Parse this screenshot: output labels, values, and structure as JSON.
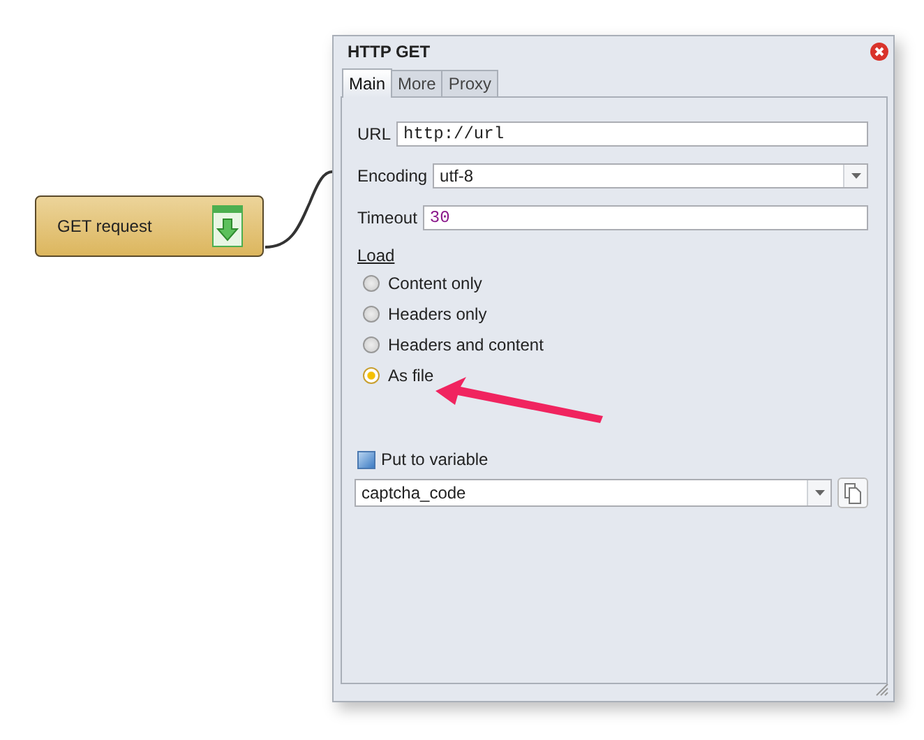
{
  "node": {
    "label": "GET request"
  },
  "dialog": {
    "title": "HTTP GET",
    "tabs": [
      {
        "label": "Main",
        "selected": true
      },
      {
        "label": "More",
        "selected": false
      },
      {
        "label": "Proxy",
        "selected": false
      }
    ],
    "fields": [
      {
        "kind": "code",
        "label": "URL",
        "value": "http://url"
      },
      {
        "kind": "combo",
        "label": "Encoding",
        "value": "utf-8"
      },
      {
        "kind": "number",
        "label": "Timeout",
        "value": "30"
      }
    ],
    "load": {
      "label": "Load",
      "options": [
        {
          "label": "Content only",
          "selected": false
        },
        {
          "label": "Headers only",
          "selected": false
        },
        {
          "label": "Headers and content",
          "selected": false
        },
        {
          "label": "As file",
          "selected": true
        }
      ]
    },
    "variable": {
      "label": "Put to variable",
      "checked": true,
      "value": "captcha_code"
    }
  }
}
